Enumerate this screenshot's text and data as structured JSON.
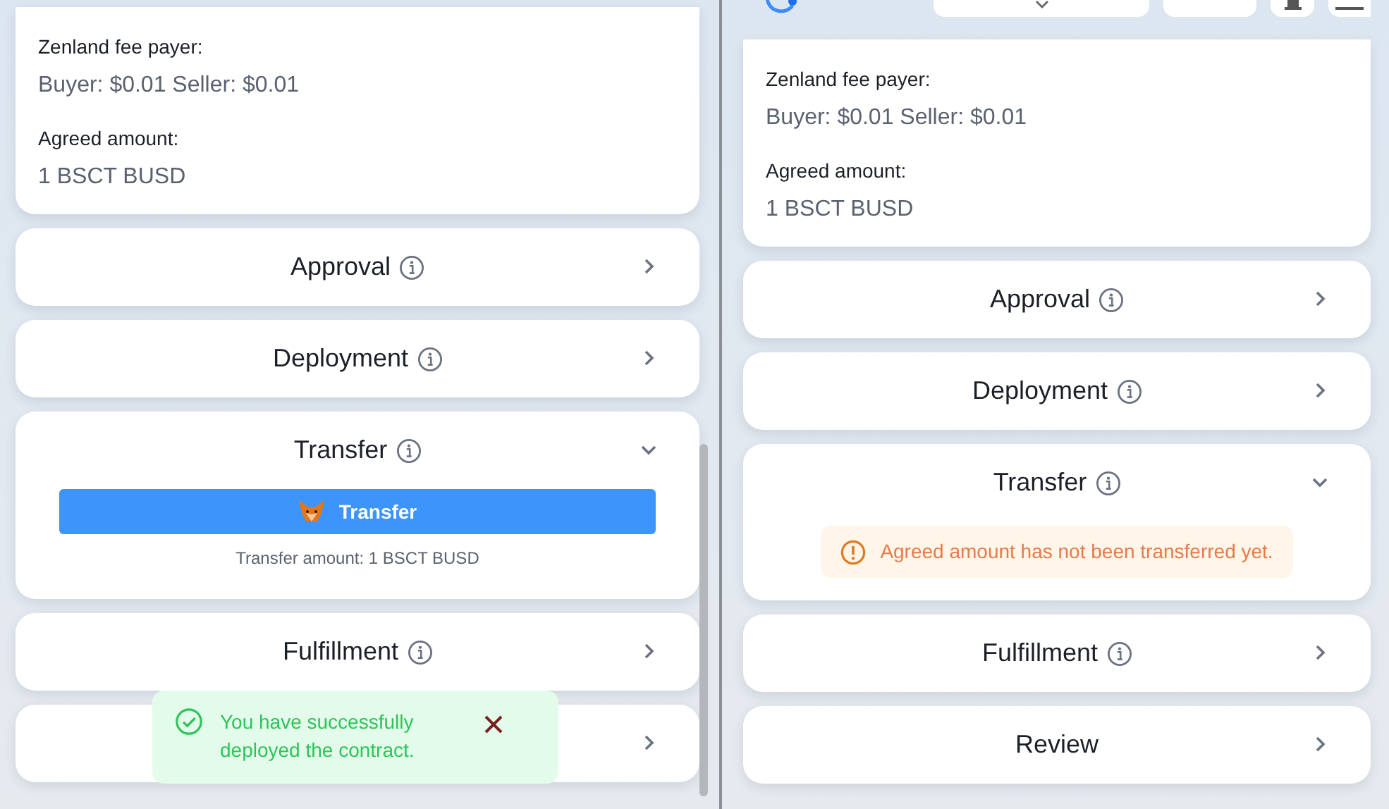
{
  "panes": [
    {
      "header": false,
      "scrollbar": true,
      "summary": [
        {
          "label": "Zenland fee payer:",
          "value": "Buyer: $0.01 Seller: $0.01"
        },
        {
          "label": "Agreed amount:",
          "value": "1 BSCT BUSD"
        }
      ],
      "steps": [
        {
          "title": "Approval",
          "info": true,
          "expanded": false
        },
        {
          "title": "Deployment",
          "info": true,
          "expanded": false
        },
        {
          "title": "Transfer",
          "info": true,
          "expanded": true,
          "content": {
            "kind": "action",
            "button": "Transfer",
            "note": "Transfer amount: 1 BSCT BUSD"
          }
        },
        {
          "title": "Fulfillment",
          "info": true,
          "expanded": false
        },
        {
          "info": false,
          "expanded": false
        }
      ],
      "toast": {
        "text": "You have successfully deployed the contract."
      }
    },
    {
      "header": true,
      "scrollbar": false,
      "summary": [
        {
          "label": "Zenland fee payer:",
          "value": "Buyer: $0.01 Seller: $0.01"
        },
        {
          "label": "Agreed amount:",
          "value": "1 BSCT BUSD"
        }
      ],
      "steps": [
        {
          "title": "Approval",
          "info": true,
          "expanded": false
        },
        {
          "title": "Deployment",
          "info": true,
          "expanded": false
        },
        {
          "title": "Transfer",
          "info": true,
          "expanded": true,
          "content": {
            "kind": "warning",
            "text": "Agreed amount has not been transferred yet."
          }
        },
        {
          "title": "Fulfillment",
          "info": true,
          "expanded": false
        },
        {
          "title": "Review",
          "info": false,
          "expanded": false
        }
      ]
    }
  ]
}
